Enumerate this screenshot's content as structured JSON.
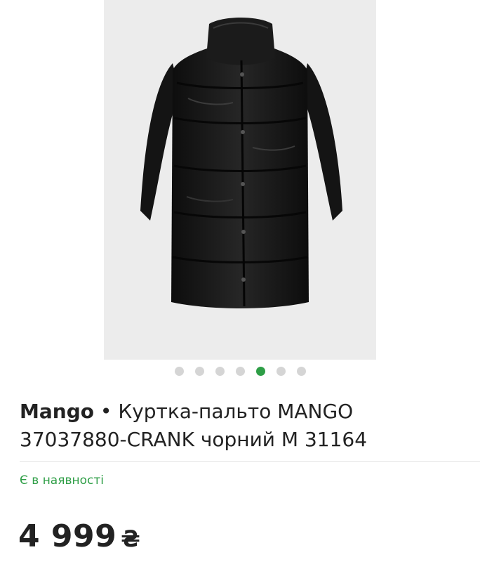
{
  "product": {
    "image_alt": "black puffer coat",
    "brand": "Mango",
    "separator": " • ",
    "name": "Куртка-пальто MANGO 37037880-CRANK чорний M 31164",
    "stock_status": "Є в наявності",
    "price_amount": "4 999",
    "price_currency": "₴"
  },
  "gallery": {
    "total_images": 7,
    "active_index": 4
  },
  "colors": {
    "accent_green": "#2e9e46",
    "dot_inactive": "#d5d5d5",
    "image_background": "#ececec"
  }
}
